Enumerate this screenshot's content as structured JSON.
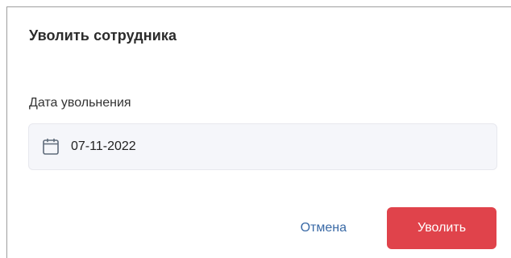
{
  "dialog": {
    "title": "Уволить сотрудника",
    "date_field": {
      "label": "Дата увольнения",
      "value": "07-11-2022",
      "icon": "calendar-icon"
    },
    "actions": {
      "cancel_label": "Отмена",
      "confirm_label": "Уволить"
    },
    "colors": {
      "confirm_button": "#e0434b",
      "cancel_link": "#3a6aa6",
      "input_background": "#f5f6fa"
    }
  }
}
